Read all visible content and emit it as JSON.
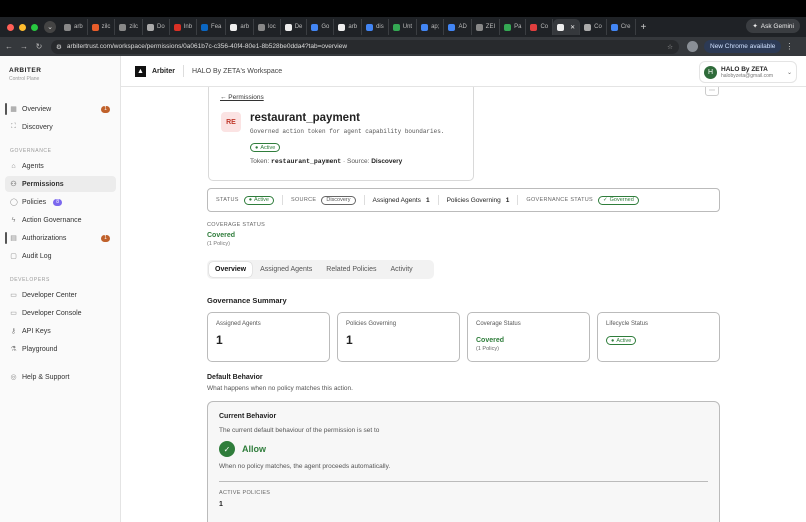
{
  "browser": {
    "tabs": [
      "arb",
      "zilc",
      "zilc",
      "Do",
      "Inb",
      "Fea",
      "arb",
      "loc",
      "De",
      "Go",
      "arb",
      "dis",
      "Unt",
      "ap;",
      "AD",
      "ZEI",
      "Pa",
      "Co",
      "",
      "Co",
      "Cre"
    ],
    "new_tab": "+",
    "ask_gemini": "Ask Gemini",
    "url": "arbitertrust.com/workspace/permissions/0a061b7c-c356-40f4-80e1-8b528be0dda4?tab=overview",
    "new_chrome": "New Chrome available",
    "colors": {
      "tabstrip": "#1f2226",
      "accent": "#2f7d3b"
    }
  },
  "sidebar": {
    "brand": "ARBITER",
    "brand_sub": "Control Plane",
    "overview": {
      "label": "Overview",
      "badge": "1"
    },
    "discovery": "Discovery",
    "governance_title": "GOVERNANCE",
    "agents": "Agents",
    "permissions": "Permissions",
    "policies": {
      "label": "Policies",
      "badge": "8"
    },
    "action_governance": "Action Governance",
    "authorizations": {
      "label": "Authorizations",
      "badge": "1"
    },
    "audit_log": "Audit Log",
    "developers_title": "DEVELOPERS",
    "developer_center": "Developer Center",
    "developer_console": "Developer Console",
    "api_keys": "API Keys",
    "playground": "Playground",
    "help": "Help & Support"
  },
  "topbar": {
    "app": "Arbiter",
    "workspace": "HALO By ZETA's Workspace",
    "user": {
      "initial": "H",
      "name": "HALO By ZETA",
      "email": "halobyzeta@gmail.com"
    }
  },
  "permission": {
    "back": "← Permissions",
    "initials": "RE",
    "title": "restaurant_payment",
    "description": "Governed action token for agent capability boundaries.",
    "status": "Active",
    "token_label": "Token:",
    "token": "restaurant_payment",
    "source_label": "Source:",
    "source": "Discovery"
  },
  "statusbar": {
    "status_label": "STATUS",
    "status": "Active",
    "source_label": "SOURCE",
    "source": "Discovery",
    "assigned_label": "Assigned Agents",
    "assigned": "1",
    "policies_label": "Policies Governing",
    "policies": "1",
    "gov_label": "GOVERNANCE STATUS",
    "gov": "Governed"
  },
  "coverage": {
    "label": "COVERAGE STATUS",
    "value": "Covered",
    "sub": "(1 Policy)"
  },
  "tabs": [
    "Overview",
    "Assigned Agents",
    "Related Policies",
    "Activity"
  ],
  "summary": {
    "title": "Governance Summary",
    "assigned": {
      "label": "Assigned Agents",
      "value": "1"
    },
    "policies": {
      "label": "Policies Governing",
      "value": "1"
    },
    "coverage": {
      "label": "Coverage Status",
      "value": "Covered",
      "sub": "(1 Policy)"
    },
    "lifecycle": {
      "label": "Lifecycle Status",
      "value": "Active"
    }
  },
  "default_behavior": {
    "title": "Default Behavior",
    "subtitle": "What happens when no policy matches this action.",
    "card_title": "Current Behavior",
    "card_desc": "The current default behaviour of the permission is set to",
    "value": "Allow",
    "note": "When no policy matches, the agent proceeds automatically.",
    "active_label": "ACTIVE POLICIES",
    "active_value": "1"
  }
}
